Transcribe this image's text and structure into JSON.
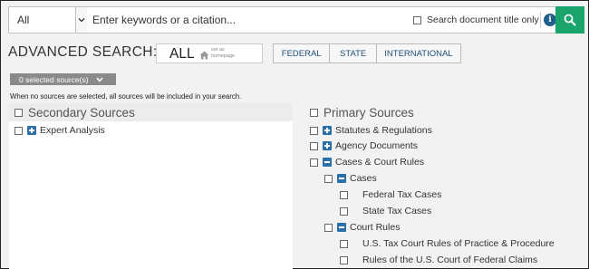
{
  "search": {
    "scope": "All",
    "placeholder": "Enter keywords or a citation...",
    "title_only_label": "Search document title only",
    "info_icon": "info-icon",
    "search_icon": "magnifier-icon"
  },
  "advanced": {
    "title": "ADVANCED SEARCH:",
    "all_label": "ALL",
    "set_home_line1": "set as",
    "set_home_line2": "homepage",
    "home_icon": "home-icon",
    "tabs": [
      "FEDERAL",
      "STATE",
      "INTERNATIONAL"
    ]
  },
  "sources": {
    "selected_label": "0 selected source(s)",
    "note": "When no sources are selected, all sources will be included in your search."
  },
  "secondary": {
    "title": "Secondary Sources",
    "items": [
      "Expert Analysis"
    ]
  },
  "primary": {
    "title": "Primary Sources",
    "items": [
      "Statutes & Regulations",
      "Agency Documents",
      "Cases & Court Rules",
      "Cases",
      "Federal Tax Cases",
      "State Tax Cases",
      "Court Rules",
      "U.S. Tax Court Rules of Practice & Procedure",
      "Rules of the U.S. Court of Federal Claims"
    ]
  },
  "colors": {
    "accent_green": "#1aa36b",
    "toggle_blue": "#2a6fa8",
    "pill_gray": "#8a8a8a",
    "link_blue": "#1f4f7a"
  }
}
